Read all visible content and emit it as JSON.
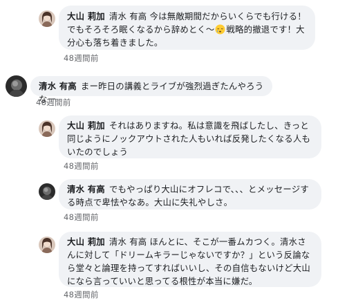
{
  "comments": [
    {
      "author": "大山 莉加",
      "mention": "清水 有高",
      "text_before_emoji": "今は無敵期間だからいくらでも行ける！でもそろそろ眠くなるから辞めとく〜",
      "emoji": "sleepy-face-emoji",
      "text_after_emoji": "戦略的撤退です！大分心も落ち着きました。",
      "timestamp": "48週間前"
    },
    {
      "author": "清水 有高",
      "text": "まー昨日の講義とライブが強烈過ぎたんやろうなー",
      "timestamp": "48週間前"
    },
    {
      "author": "大山 莉加",
      "text": "それはありますね。私は意識を飛ばしたし、きっと同じようにノックアウトされた人もいれば反発したくなる人もいたのでしょう",
      "timestamp": "48週間前"
    },
    {
      "author": "清水 有高",
      "text": "でもやっぱり大山にオフレコで、、、とメッセージする時点で卑怯やなあ。大山に失礼やしさ。",
      "timestamp": "48週間前"
    },
    {
      "author": "大山 莉加",
      "mention": "清水 有高",
      "text": "ほんとに、そこが一番ムカつく。清水さんに対して「ドリームキラーじゃないですか？」という反論なら堂々と論理を持ってすればいいし、その自信もないけど大山になら言っていいと思ってる根性が本当に嫌だ。",
      "timestamp": "48週間前"
    }
  ],
  "colors": {
    "bubble": "#f0f2f5",
    "text": "#1c1e21",
    "timestamp": "#65676b"
  }
}
